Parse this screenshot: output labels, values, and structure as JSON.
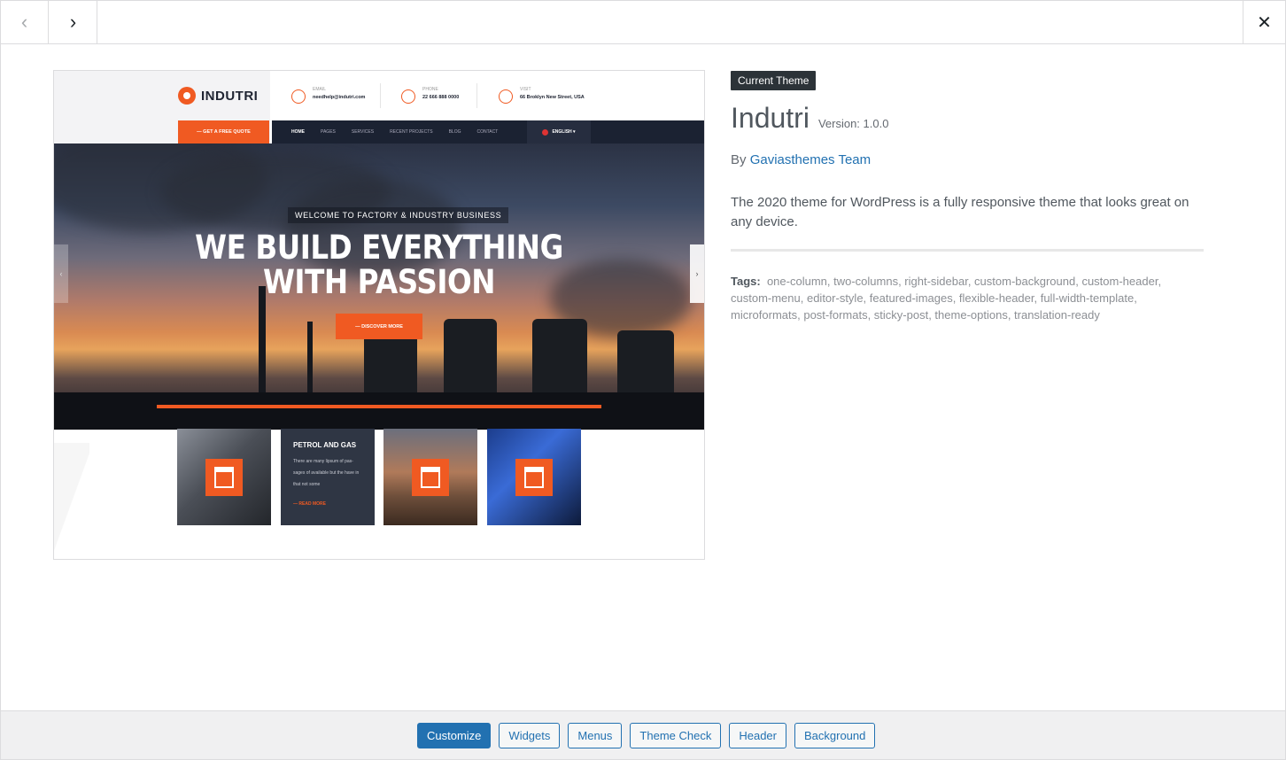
{
  "nav": {
    "prev_icon": "‹",
    "next_icon": "›",
    "close_icon": "✕"
  },
  "screenshot": {
    "logo": "INDUTRI",
    "contacts": [
      {
        "label": "EMAIL",
        "value": "needhelp@indutri.com"
      },
      {
        "label": "PHONE",
        "value": "22 666 888 0000"
      },
      {
        "label": "VISIT",
        "value": "66 Broklyn New Street, USA"
      }
    ],
    "quote_button": "— GET A FREE QUOTE",
    "menu": [
      "HOME",
      "PAGES",
      "SERVICES",
      "RECENT PROJECTS",
      "BLOG",
      "CONTACT"
    ],
    "language": "ENGLISH ▾",
    "hero_subtitle": "WELCOME TO FACTORY & INDUSTRY BUSINESS",
    "hero_title_line1": "WE BUILD EVERYTHING",
    "hero_title_line2": "WITH PASSION",
    "hero_button": "— DISCOVER MORE",
    "slider_prev": "‹",
    "slider_next": "›",
    "card2": {
      "title": "PETROL AND GAS",
      "text": "There are many lipsum of pas-sages of available but the have in that not some",
      "link": "— READ MORE"
    }
  },
  "theme": {
    "badge": "Current Theme",
    "name": "Indutri",
    "version": "Version: 1.0.0",
    "by": "By",
    "author": "Gaviasthemes Team",
    "description": "The 2020 theme for WordPress is a fully responsive theme that looks great on any device.",
    "tags_label": "Tags:",
    "tags": "one-column, two-columns, right-sidebar, custom-background, custom-header, custom-menu, editor-style, featured-images, flexible-header, full-width-template, microformats, post-formats, sticky-post, theme-options, translation-ready"
  },
  "actions": {
    "customize": "Customize",
    "widgets": "Widgets",
    "menus": "Menus",
    "theme_check": "Theme Check",
    "header": "Header",
    "background": "Background"
  },
  "colors": {
    "accent": "#2271b1",
    "brand_orange": "#f05a22",
    "badge_bg": "#2c3338"
  }
}
